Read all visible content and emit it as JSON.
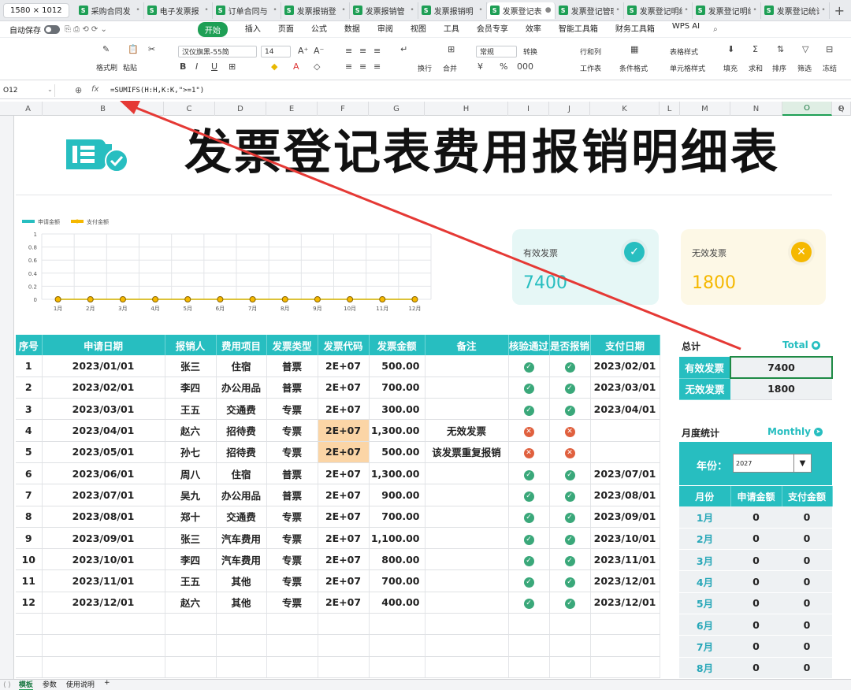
{
  "tabbar": {
    "resolution": "1580 × 1012",
    "tabs": [
      {
        "label": "采购合同发"
      },
      {
        "label": "电子发票报"
      },
      {
        "label": "订单合同与"
      },
      {
        "label": "发票报销登"
      },
      {
        "label": "发票报销管"
      },
      {
        "label": "发票报销明"
      },
      {
        "label": "发票登记表"
      },
      {
        "label": "发票登记管理"
      },
      {
        "label": "发票登记明细"
      },
      {
        "label": "发票登记明细"
      },
      {
        "label": "发票登记统计"
      }
    ],
    "add_label": "+"
  },
  "menubar": {
    "autosave": "自动保存",
    "items": [
      "开始",
      "插入",
      "页面",
      "公式",
      "数据",
      "审阅",
      "视图",
      "工具",
      "会员专享",
      "效率",
      "智能工具箱",
      "财务工具箱",
      "WPS AI"
    ]
  },
  "ribbon": {
    "format_painter": "格式刷",
    "paste": "粘贴",
    "font_name": "汉仪旗黑-55简",
    "font_size": "14",
    "number_format": "常规",
    "convert": "转换",
    "rows_cols": "行和列",
    "worksheet": "工作表",
    "wrap": "换行",
    "merge": "合并",
    "cond_format": "条件格式",
    "table_style": "表格样式",
    "cell_style": "单元格样式",
    "fill": "填充",
    "sum": "求和",
    "sort": "排序",
    "filter": "筛选",
    "freeze": "冻结"
  },
  "formula": {
    "cell_ref": "O12",
    "fx": "fx",
    "formula": "=SUMIFS(H:H,K:K,\">=1\")"
  },
  "columns": [
    "A",
    "B",
    "C",
    "D",
    "E",
    "F",
    "G",
    "H",
    "I",
    "J",
    "K",
    "L",
    "M",
    "N",
    "O",
    "P",
    "Q"
  ],
  "sheet": {
    "title": "发票登记表费用报销明细表",
    "chart_data": {
      "type": "line",
      "categories": [
        "1月",
        "2月",
        "3月",
        "4月",
        "5月",
        "6月",
        "7月",
        "8月",
        "9月",
        "10月",
        "11月",
        "12月"
      ],
      "series": [
        {
          "name": "申请金额",
          "values": [
            0,
            0,
            0,
            0,
            0,
            0,
            0,
            0,
            0,
            0,
            0,
            0
          ],
          "color": "#27bec0"
        },
        {
          "name": "支付金额",
          "values": [
            0,
            0,
            0,
            0,
            0,
            0,
            0,
            0,
            0,
            0,
            0,
            0
          ],
          "color": "#f5b800"
        }
      ],
      "ylim": [
        0,
        1
      ],
      "yticks": [
        "0",
        "0.2",
        "0.4",
        "0.6",
        "0.8",
        "1"
      ],
      "grid": true,
      "legend": "top-left"
    },
    "cards": [
      {
        "label": "有效发票",
        "value": "7400",
        "color": "#27bec0",
        "bg": "#e6f7f6",
        "icon": "check-icon"
      },
      {
        "label": "无效发票",
        "value": "1800",
        "color": "#f5b800",
        "bg": "#fdf8e6",
        "icon": "close-icon"
      }
    ],
    "table": {
      "headers": [
        "序号",
        "申请日期",
        "报销人",
        "费用项目",
        "发票类型",
        "发票代码",
        "发票金额",
        "备注",
        "核验通过",
        "是否报销",
        "支付日期"
      ],
      "rows": [
        {
          "no": "1",
          "date": "2023/01/01",
          "person": "张三",
          "item": "住宿",
          "type": "普票",
          "code": "2E+07",
          "amount": "500.00",
          "note": "",
          "verified": true,
          "reimbursed": true,
          "paydate": "2023/02/01"
        },
        {
          "no": "2",
          "date": "2023/02/01",
          "person": "李四",
          "item": "办公用品",
          "type": "普票",
          "code": "2E+07",
          "amount": "700.00",
          "note": "",
          "verified": true,
          "reimbursed": true,
          "paydate": "2023/03/01"
        },
        {
          "no": "3",
          "date": "2023/03/01",
          "person": "王五",
          "item": "交通费",
          "type": "专票",
          "code": "2E+07",
          "amount": "300.00",
          "note": "",
          "verified": true,
          "reimbursed": true,
          "paydate": "2023/04/01"
        },
        {
          "no": "4",
          "date": "2023/04/01",
          "person": "赵六",
          "item": "招待费",
          "type": "专票",
          "code": "2E+07",
          "amount": "1,300.00",
          "note": "无效发票",
          "verified": false,
          "reimbursed": false,
          "paydate": "",
          "hl": true
        },
        {
          "no": "5",
          "date": "2023/05/01",
          "person": "孙七",
          "item": "招待费",
          "type": "专票",
          "code": "2E+07",
          "amount": "500.00",
          "note": "该发票重复报销",
          "verified": false,
          "reimbursed": false,
          "paydate": "",
          "hl": true
        },
        {
          "no": "6",
          "date": "2023/06/01",
          "person": "周八",
          "item": "住宿",
          "type": "普票",
          "code": "2E+07",
          "amount": "1,300.00",
          "note": "",
          "verified": true,
          "reimbursed": true,
          "paydate": "2023/07/01"
        },
        {
          "no": "7",
          "date": "2023/07/01",
          "person": "吴九",
          "item": "办公用品",
          "type": "普票",
          "code": "2E+07",
          "amount": "900.00",
          "note": "",
          "verified": true,
          "reimbursed": true,
          "paydate": "2023/08/01"
        },
        {
          "no": "8",
          "date": "2023/08/01",
          "person": "郑十",
          "item": "交通费",
          "type": "专票",
          "code": "2E+07",
          "amount": "700.00",
          "note": "",
          "verified": true,
          "reimbursed": true,
          "paydate": "2023/09/01"
        },
        {
          "no": "9",
          "date": "2023/09/01",
          "person": "张三",
          "item": "汽车费用",
          "type": "专票",
          "code": "2E+07",
          "amount": "1,100.00",
          "note": "",
          "verified": true,
          "reimbursed": true,
          "paydate": "2023/10/01"
        },
        {
          "no": "10",
          "date": "2023/10/01",
          "person": "李四",
          "item": "汽车费用",
          "type": "专票",
          "code": "2E+07",
          "amount": "800.00",
          "note": "",
          "verified": true,
          "reimbursed": true,
          "paydate": "2023/11/01"
        },
        {
          "no": "11",
          "date": "2023/11/01",
          "person": "王五",
          "item": "其他",
          "type": "专票",
          "code": "2E+07",
          "amount": "700.00",
          "note": "",
          "verified": true,
          "reimbursed": true,
          "paydate": "2023/12/01"
        },
        {
          "no": "12",
          "date": "2023/12/01",
          "person": "赵六",
          "item": "其他",
          "type": "专票",
          "code": "2E+07",
          "amount": "400.00",
          "note": "",
          "verified": true,
          "reimbursed": true,
          "paydate": "2023/12/01"
        }
      ]
    },
    "total": {
      "label": "总计",
      "link": "Total",
      "rows": [
        {
          "k": "有效发票",
          "v": "7400"
        },
        {
          "k": "无效发票",
          "v": "1800"
        }
      ]
    },
    "monthly": {
      "label": "月度统计",
      "link": "Monthly",
      "year_label": "年份：",
      "year_value": "2027",
      "headers": [
        "月份",
        "申请金额",
        "支付金额"
      ],
      "rows": [
        {
          "m": "1月",
          "a": "0",
          "p": "0"
        },
        {
          "m": "2月",
          "a": "0",
          "p": "0"
        },
        {
          "m": "3月",
          "a": "0",
          "p": "0"
        },
        {
          "m": "4月",
          "a": "0",
          "p": "0"
        },
        {
          "m": "5月",
          "a": "0",
          "p": "0"
        },
        {
          "m": "6月",
          "a": "0",
          "p": "0"
        },
        {
          "m": "7月",
          "a": "0",
          "p": "0"
        },
        {
          "m": "8月",
          "a": "0",
          "p": "0"
        }
      ]
    }
  },
  "sheettabs": [
    "模板",
    "参数",
    "使用说明",
    "+"
  ]
}
